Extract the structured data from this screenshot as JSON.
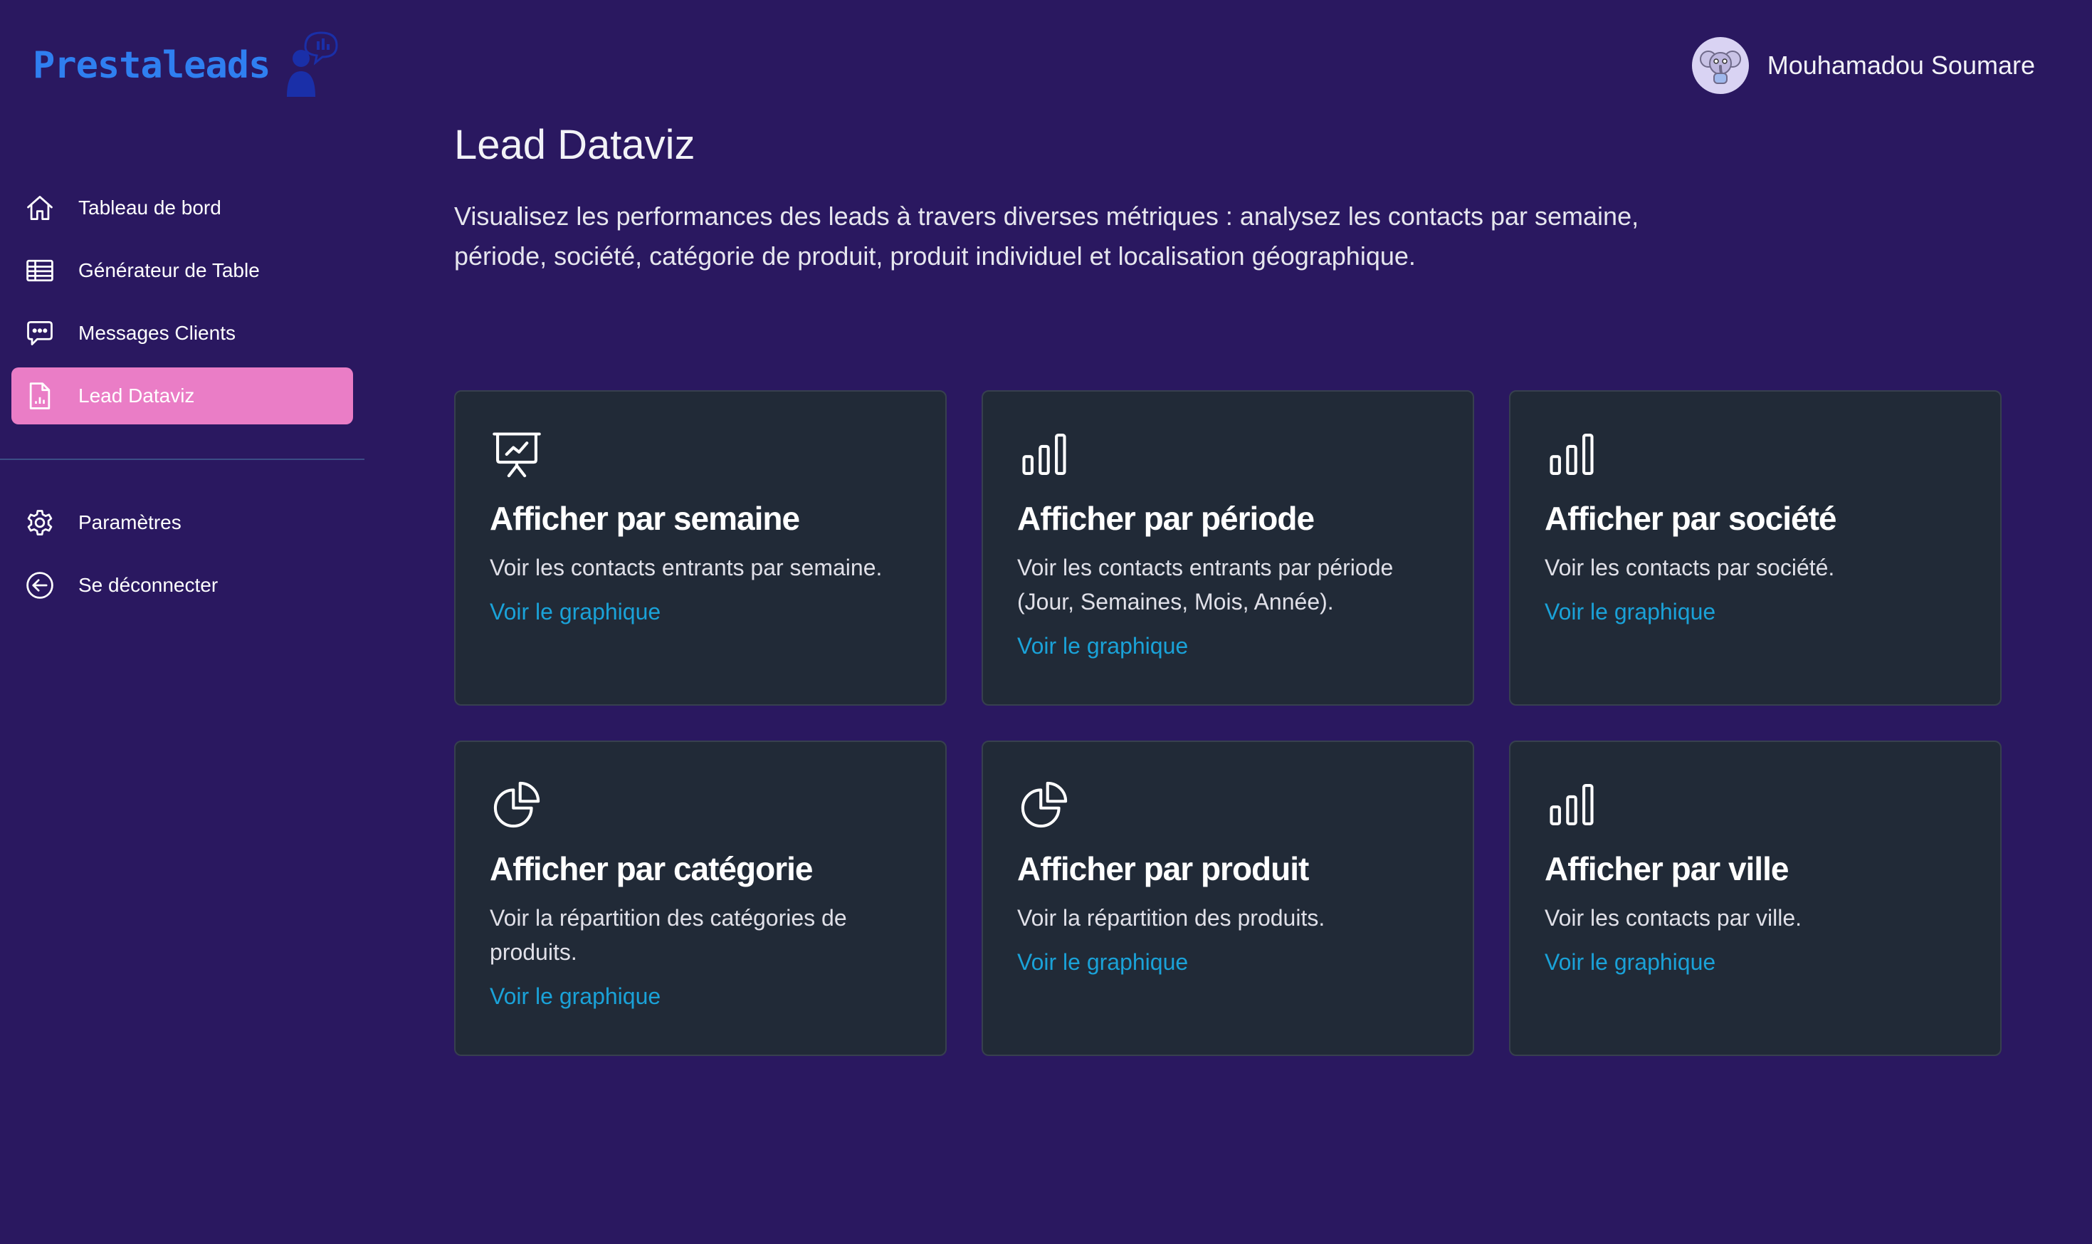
{
  "app": {
    "logo_text": "Prestaleads"
  },
  "user": {
    "name": "Mouhamadou Soumare"
  },
  "sidebar": {
    "items": [
      {
        "label": "Tableau de bord",
        "icon": "home-icon",
        "active": false
      },
      {
        "label": "Générateur de Table",
        "icon": "table-icon",
        "active": false
      },
      {
        "label": "Messages Clients",
        "icon": "chat-icon",
        "active": false
      },
      {
        "label": "Lead Dataviz",
        "icon": "document-chart-icon",
        "active": true
      }
    ],
    "secondary": [
      {
        "label": "Paramètres",
        "icon": "gear-icon"
      },
      {
        "label": "Se déconnecter",
        "icon": "logout-icon"
      }
    ]
  },
  "page": {
    "title": "Lead Dataviz",
    "description": "Visualisez les performances des leads à travers diverses métriques : analysez les contacts par semaine, période, société, catégorie de produit, produit individuel et localisation géographique."
  },
  "cards": [
    {
      "title": "Afficher par semaine",
      "description": "Voir les contacts entrants par semaine.",
      "link": "Voir le graphique",
      "icon": "presentation-chart-icon"
    },
    {
      "title": "Afficher par période",
      "description": "Voir les contacts entrants par période (Jour, Semaines, Mois, Année).",
      "link": "Voir le graphique",
      "icon": "bar-chart-icon"
    },
    {
      "title": "Afficher par société",
      "description": "Voir les contacts par société.",
      "link": "Voir le graphique",
      "icon": "bar-chart-icon"
    },
    {
      "title": "Afficher par catégorie",
      "description": "Voir la répartition des catégories de produits.",
      "link": "Voir le graphique",
      "icon": "pie-chart-icon"
    },
    {
      "title": "Afficher par produit",
      "description": "Voir la répartition des produits.",
      "link": "Voir le graphique",
      "icon": "pie-chart-icon"
    },
    {
      "title": "Afficher par ville",
      "description": "Voir les contacts par ville.",
      "link": "Voir le graphique",
      "icon": "bar-chart-icon"
    }
  ],
  "colors": {
    "background": "#2a1860",
    "card": "#212a37",
    "active_nav": "#ea7dc6",
    "link": "#1aa2d8",
    "logo": "#2f7ff0"
  }
}
